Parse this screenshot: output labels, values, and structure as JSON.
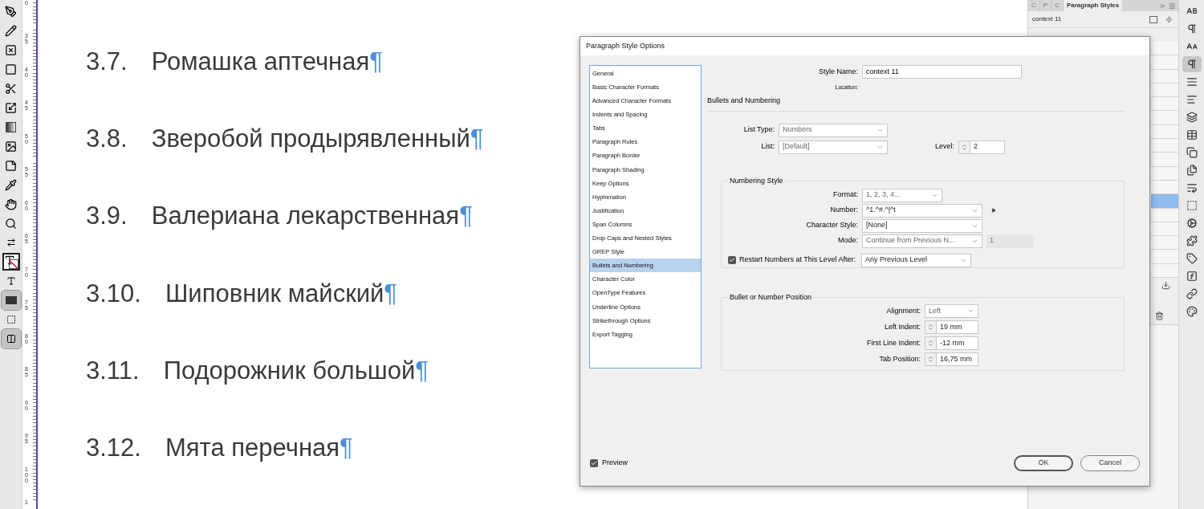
{
  "tools": [
    {
      "kind": "pen",
      "selected": false
    },
    {
      "kind": "pencil",
      "selected": false
    },
    {
      "kind": "frame",
      "selected": false
    },
    {
      "kind": "rectangle",
      "selected": false
    },
    {
      "kind": "scissors",
      "selected": false
    },
    {
      "kind": "transform",
      "selected": false
    },
    {
      "kind": "gradient",
      "selected": false
    },
    {
      "kind": "feather",
      "selected": false
    },
    {
      "kind": "note",
      "selected": false
    },
    {
      "kind": "eyedropper",
      "selected": false
    },
    {
      "kind": "hand",
      "selected": false
    },
    {
      "kind": "zoom",
      "selected": false
    },
    {
      "kind": "swap",
      "selected": false
    },
    {
      "kind": "fill-stroke",
      "selected": false
    },
    {
      "kind": "format",
      "selected": false
    },
    {
      "kind": "fill-box",
      "selected": true
    },
    {
      "kind": "mode",
      "selected": false
    },
    {
      "kind": "view",
      "selected": true
    }
  ],
  "ruler": {
    "labels": [
      "0",
      "35",
      "40",
      "45",
      "50",
      "55",
      "60",
      "65",
      "70",
      "75",
      "80",
      "85",
      "90",
      "95",
      "100",
      "1"
    ]
  },
  "document": {
    "items": [
      {
        "number": "3.7.",
        "text": "Ромашка аптечная",
        "mark": "¶"
      },
      {
        "number": "3.8.",
        "text": "Зверобой продырявленный",
        "mark": "¶"
      },
      {
        "number": "3.9.",
        "text": "Валериана лекарственная",
        "mark": "¶"
      },
      {
        "number": "3.10.",
        "text": "Шиповник майский",
        "mark": "¶"
      },
      {
        "number": "3.11.",
        "text": "Подорожник большой",
        "mark": "¶"
      },
      {
        "number": "3.12.",
        "text": "Мята перечная",
        "mark": "¶"
      }
    ]
  },
  "panel": {
    "tabs": [
      {
        "label": "C",
        "selected": false
      },
      {
        "label": "P",
        "selected": false
      },
      {
        "label": "C",
        "selected": false
      },
      {
        "label": "Paragraph Styles",
        "selected": true
      }
    ],
    "current_style": "context 11",
    "rows": [
      {
        "selected": false
      },
      {
        "selected": false
      },
      {
        "selected": false
      },
      {
        "selected": false
      },
      {
        "selected": false
      },
      {
        "selected": false
      },
      {
        "selected": false
      },
      {
        "selected": false
      },
      {
        "selected": false
      },
      {
        "selected": false
      },
      {
        "selected": false
      },
      {
        "selected": true
      },
      {
        "selected": false
      },
      {
        "selected": false
      },
      {
        "selected": false
      },
      {
        "selected": false
      },
      {
        "selected": false
      }
    ]
  },
  "panel_icons": [
    {
      "kind": "character",
      "selected": false
    },
    {
      "kind": "paragraph",
      "selected": false
    },
    {
      "kind": "char-style",
      "selected": false
    },
    {
      "kind": "para-style",
      "selected": true
    },
    {
      "kind": "stroke",
      "selected": false
    },
    {
      "kind": "align",
      "selected": false
    },
    {
      "kind": "pathfinder",
      "selected": false
    },
    {
      "kind": "table",
      "selected": false
    },
    {
      "kind": "cell-style",
      "selected": false
    },
    {
      "kind": "table-style",
      "selected": false
    },
    {
      "kind": "text-wrap",
      "selected": false
    },
    {
      "kind": "wrap-shape",
      "selected": false
    },
    {
      "kind": "scripts",
      "selected": false
    },
    {
      "kind": "script",
      "selected": false
    },
    {
      "kind": "script-label",
      "selected": false
    },
    {
      "kind": "effects",
      "selected": false
    },
    {
      "kind": "links",
      "selected": false
    },
    {
      "kind": "color",
      "selected": false
    }
  ],
  "dialog": {
    "title": "Paragraph Style Options",
    "categories": [
      {
        "label": "General",
        "selected": false
      },
      {
        "label": "Basic Character Formats",
        "selected": false
      },
      {
        "label": "Advanced Character Formats",
        "selected": false
      },
      {
        "label": "Indents and Spacing",
        "selected": false
      },
      {
        "label": "Tabs",
        "selected": false
      },
      {
        "label": "Paragraph Rules",
        "selected": false
      },
      {
        "label": "Paragraph Border",
        "selected": false
      },
      {
        "label": "Paragraph Shading",
        "selected": false
      },
      {
        "label": "Keep Options",
        "selected": false
      },
      {
        "label": "Hyphenation",
        "selected": false
      },
      {
        "label": "Justification",
        "selected": false
      },
      {
        "label": "Span Columns",
        "selected": false
      },
      {
        "label": "Drop Caps and Nested Styles",
        "selected": false
      },
      {
        "label": "GREP Style",
        "selected": false
      },
      {
        "label": "Bullets and Numbering",
        "selected": true
      },
      {
        "label": "Character Color",
        "selected": false
      },
      {
        "label": "OpenType Features",
        "selected": false
      },
      {
        "label": "Underline Options",
        "selected": false
      },
      {
        "label": "Strikethrough Options",
        "selected": false
      },
      {
        "label": "Export Tagging",
        "selected": false
      }
    ],
    "style_name": {
      "label": "Style Name:",
      "value": "context 11"
    },
    "location": {
      "label": "Location:"
    },
    "section_title": "Bullets and Numbering",
    "list_type": {
      "label": "List Type:",
      "value": "Numbers"
    },
    "list": {
      "label": "List:",
      "value": "[Default]"
    },
    "level": {
      "label": "Level:",
      "value": "2"
    },
    "numbering_style": {
      "title": "Numbering Style",
      "fields": [
        {
          "kind": "select",
          "label": "Format:",
          "value": "1, 2, 3, 4..."
        },
        {
          "kind": "combo",
          "label": "Number:",
          "value": "^1.^#.^|^t"
        },
        {
          "kind": "combo",
          "label": "Character Style:",
          "value": "[None]"
        },
        {
          "kind": "select",
          "label": "Mode:",
          "value": "Continue from Previous N...",
          "extra": "1"
        }
      ],
      "restart": {
        "label": "Restart Numbers at This Level After:",
        "checked": true,
        "value": "Any Previous Level"
      }
    },
    "position": {
      "title": "Bullet or Number Position",
      "fields": [
        {
          "kind": "select",
          "label": "Alignment:",
          "value": "Left"
        },
        {
          "kind": "spinner",
          "label": "Left Indent:",
          "value": "19 mm"
        },
        {
          "kind": "spinner",
          "label": "First Line Indent:",
          "value": "-12 mm"
        },
        {
          "kind": "spinner",
          "label": "Tab Position:",
          "value": "16,75 mm"
        }
      ]
    },
    "preview": {
      "label": "Preview",
      "checked": true
    },
    "buttons": [
      {
        "label": "OK",
        "default": true
      },
      {
        "label": "Cancel",
        "default": false
      }
    ]
  }
}
